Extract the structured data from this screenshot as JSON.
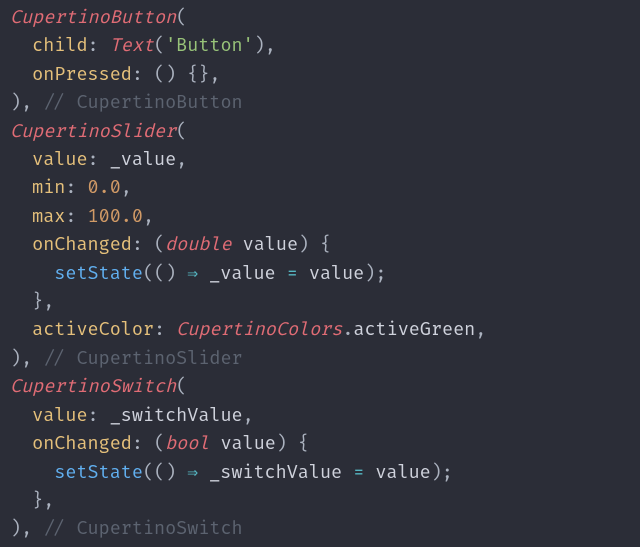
{
  "t": {
    "CupertinoButton": "CupertinoButton",
    "child": "child",
    "Text": "Text",
    "ButtonStr": "'Button'",
    "onPressed": "onPressed",
    "commentCupertinoButton": "// CupertinoButton",
    "CupertinoSlider": "CupertinoSlider",
    "value": "value",
    "_value": "_value",
    "min": "min",
    "zero": "0.0",
    "max": "max",
    "hundred": "100.0",
    "onChanged": "onChanged",
    "double": "double",
    "valueId": "value",
    "setState": "setState",
    "arrow": "⇒",
    "activeColor": "activeColor",
    "CupertinoColors": "CupertinoColors",
    "activeGreen": "activeGreen",
    "commentCupertinoSlider": "// CupertinoSlider",
    "CupertinoSwitch": "CupertinoSwitch",
    "_switchValue": "_switchValue",
    "bool": "bool",
    "commentCupertinoSwitch": "// CupertinoSwitch"
  }
}
